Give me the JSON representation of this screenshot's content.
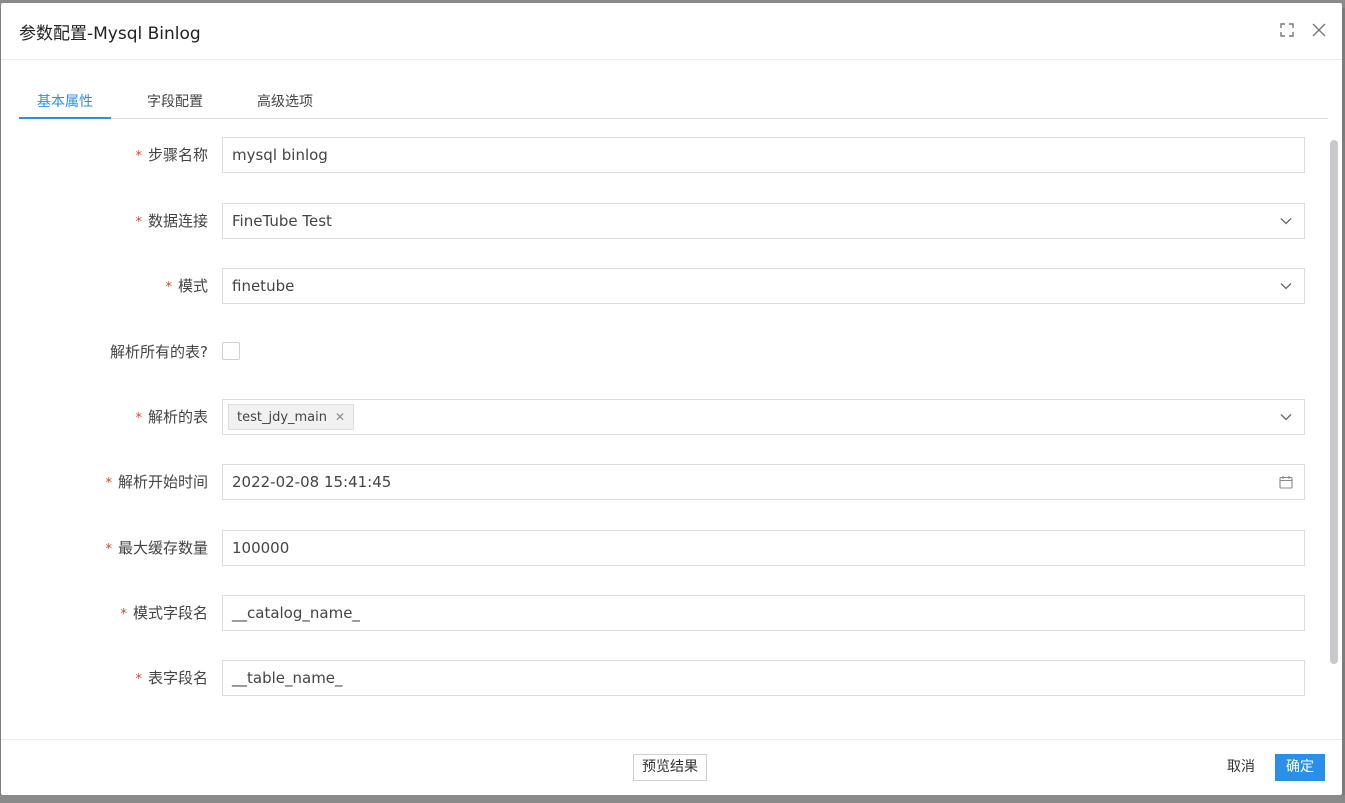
{
  "dialog": {
    "title": "参数配置-Mysql Binlog",
    "icons": [
      "fullscreen-icon",
      "close-icon"
    ]
  },
  "tabs": [
    {
      "label": "基本属性",
      "active": true
    },
    {
      "label": "字段配置",
      "active": false
    },
    {
      "label": "高级选项",
      "active": false
    }
  ],
  "form": {
    "required_mark": "*",
    "step_name": {
      "label": "步骤名称",
      "value": "mysql binlog"
    },
    "data_connection": {
      "label": "数据连接",
      "value": "FineTube Test"
    },
    "schema": {
      "label": "模式",
      "value": "finetube"
    },
    "parse_all_tables": {
      "label": "解析所有的表?",
      "checked": false
    },
    "parsed_tables": {
      "label": "解析的表",
      "tags": [
        "test_jdy_main"
      ]
    },
    "parse_start_time": {
      "label": "解析开始时间",
      "value": "2022-02-08 15:41:45"
    },
    "max_cache_count": {
      "label": "最大缓存数量",
      "value": "100000"
    },
    "schema_field_name": {
      "label": "模式字段名",
      "value": "__catalog_name_"
    },
    "table_field_name": {
      "label": "表字段名",
      "value": "__table_name_"
    }
  },
  "footer": {
    "preview_label": "预览结果",
    "cancel_label": "取消",
    "ok_label": "确定"
  },
  "colors": {
    "accent": "#2b8fe8",
    "required": "#d8432b"
  }
}
